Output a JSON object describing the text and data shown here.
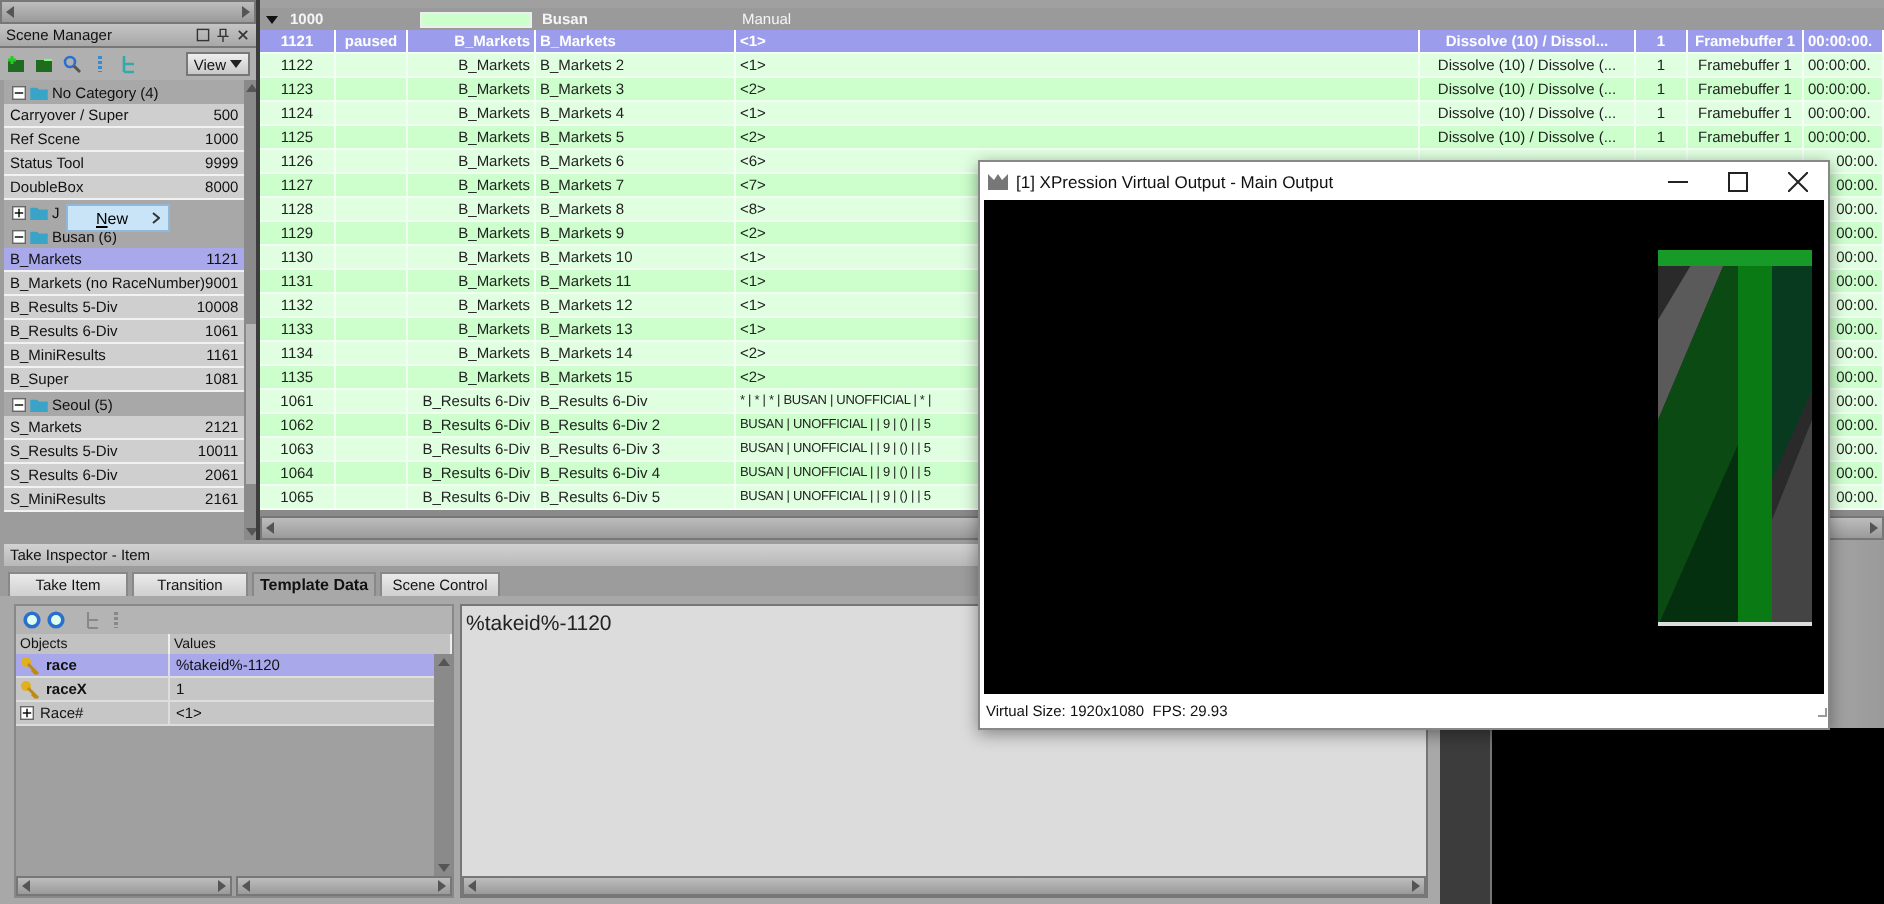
{
  "scene_manager": {
    "title": "Scene Manager",
    "view_button": "View",
    "context_menu": {
      "label": "New"
    },
    "folders": [
      {
        "label": "No Category",
        "count": "(4)",
        "expanded": true,
        "children": [
          {
            "name": "Carryover / Super",
            "number": "500",
            "selected": false
          },
          {
            "name": "Ref Scene",
            "number": "1000",
            "selected": false
          },
          {
            "name": "Status Tool",
            "number": "9999",
            "selected": false
          },
          {
            "name": "DoubleBox",
            "number": "8000",
            "selected": false
          }
        ]
      },
      {
        "label": "J",
        "expanded": false
      },
      {
        "label": "Busan",
        "count": "(6)",
        "expanded": true,
        "children": [
          {
            "name": "B_Markets",
            "number": "1121",
            "selected": true
          },
          {
            "name": "B_Markets (no RaceNumber)",
            "number": "9001",
            "selected": false
          },
          {
            "name": "B_Results 5-Div",
            "number": "10008",
            "selected": false
          },
          {
            "name": "B_Results 6-Div",
            "number": "1061",
            "selected": false
          },
          {
            "name": "B_MiniResults",
            "number": "1161",
            "selected": false
          },
          {
            "name": "B_Super",
            "number": "1081",
            "selected": false
          }
        ]
      },
      {
        "label": "Seoul",
        "count": "(5)",
        "expanded": true,
        "children": [
          {
            "name": "S_Markets",
            "number": "2121",
            "selected": false
          },
          {
            "name": "S_Results 5-Div",
            "number": "10011",
            "selected": false
          },
          {
            "name": "S_Results 6-Div",
            "number": "2061",
            "selected": false
          },
          {
            "name": "S_MiniResults",
            "number": "2161",
            "selected": false
          }
        ]
      }
    ]
  },
  "playlist": {
    "group": {
      "id": "1000",
      "expanded": true,
      "name": "Busan",
      "column": "Manual"
    },
    "rows": [
      {
        "id": "1121",
        "status": "paused",
        "scene": "B_Markets",
        "name": "B_Markets",
        "manual": "<1>",
        "transition": "Dissolve (10) / Dissol...",
        "count": "1",
        "framebuffer": "Framebuffer 1",
        "time": "00:00:00.",
        "selected": true
      },
      {
        "id": "1122",
        "scene": "B_Markets",
        "name": "B_Markets 2",
        "manual": "<1>",
        "transition": "Dissolve (10) / Dissolve (...",
        "count": "1",
        "framebuffer": "Framebuffer 1",
        "time": "00:00:00.",
        "selected": false
      },
      {
        "id": "1123",
        "scene": "B_Markets",
        "name": "B_Markets 3",
        "manual": "<2>",
        "transition": "Dissolve (10) / Dissolve (...",
        "count": "1",
        "framebuffer": "Framebuffer 1",
        "time": "00:00:00.",
        "selected": false
      },
      {
        "id": "1124",
        "scene": "B_Markets",
        "name": "B_Markets 4",
        "manual": "<1>",
        "transition": "Dissolve (10) / Dissolve (...",
        "count": "1",
        "framebuffer": "Framebuffer 1",
        "time": "00:00:00.",
        "selected": false
      },
      {
        "id": "1125",
        "scene": "B_Markets",
        "name": "B_Markets 5",
        "manual": "<2>",
        "transition": "Dissolve (10) / Dissolve (...",
        "count": "1",
        "framebuffer": "Framebuffer 1",
        "time": "00:00:00.",
        "selected": false
      },
      {
        "id": "1126",
        "scene": "B_Markets",
        "name": "B_Markets 6",
        "manual": "<6>",
        "time": "00:00.",
        "selected": false
      },
      {
        "id": "1127",
        "scene": "B_Markets",
        "name": "B_Markets 7",
        "manual": "<7>",
        "time": "00:00.",
        "selected": false
      },
      {
        "id": "1128",
        "scene": "B_Markets",
        "name": "B_Markets 8",
        "manual": "<8>",
        "time": "00:00.",
        "selected": false
      },
      {
        "id": "1129",
        "scene": "B_Markets",
        "name": "B_Markets 9",
        "manual": "<2>",
        "time": "00:00.",
        "selected": false
      },
      {
        "id": "1130",
        "scene": "B_Markets",
        "name": "B_Markets 10",
        "manual": "<1>",
        "time": "00:00.",
        "selected": false
      },
      {
        "id": "1131",
        "scene": "B_Markets",
        "name": "B_Markets 11",
        "manual": "<1>",
        "time": "00:00.",
        "selected": false
      },
      {
        "id": "1132",
        "scene": "B_Markets",
        "name": "B_Markets 12",
        "manual": "<1>",
        "time": "00:00.",
        "selected": false
      },
      {
        "id": "1133",
        "scene": "B_Markets",
        "name": "B_Markets 13",
        "manual": "<1>",
        "time": "00:00.",
        "selected": false
      },
      {
        "id": "1134",
        "scene": "B_Markets",
        "name": "B_Markets 14",
        "manual": "<2>",
        "time": "00:00.",
        "selected": false
      },
      {
        "id": "1135",
        "scene": "B_Markets",
        "name": "B_Markets 15",
        "manual": "<2>",
        "time": "00:00.",
        "selected": false
      },
      {
        "id": "1061",
        "scene": "B_Results 6-Div",
        "name": "B_Results 6-Div",
        "manual": "* | * | * | BUSAN | UNOFFICIAL | * |",
        "time": "00:00.",
        "selected": false
      },
      {
        "id": "1062",
        "scene": "B_Results 6-Div",
        "name": "B_Results 6-Div 2",
        "manual": "BUSAN | UNOFFICIAL | | 9 | () | | 5",
        "time": "00:00.",
        "selected": false
      },
      {
        "id": "1063",
        "scene": "B_Results 6-Div",
        "name": "B_Results 6-Div 3",
        "manual": "BUSAN | UNOFFICIAL | | 9 | () | | 5",
        "time": "00:00.",
        "selected": false
      },
      {
        "id": "1064",
        "scene": "B_Results 6-Div",
        "name": "B_Results 6-Div 4",
        "manual": "BUSAN | UNOFFICIAL | | 9 | () | | 5",
        "time": "00:00.",
        "selected": false
      },
      {
        "id": "1065",
        "scene": "B_Results 6-Div",
        "name": "B_Results 6-Div 5",
        "manual": "BUSAN | UNOFFICIAL | | 9 | () | | 5",
        "time": "00:00.",
        "selected": false
      }
    ]
  },
  "take_inspector": {
    "title": "Take Inspector - Item",
    "tabs": [
      {
        "label": "Take Item",
        "selected": false
      },
      {
        "label": "Transition",
        "selected": false
      },
      {
        "label": "Template Data",
        "selected": true
      },
      {
        "label": "Scene Control",
        "selected": false
      }
    ],
    "columns": [
      "Objects",
      "Values"
    ],
    "objects": [
      {
        "kind": "key",
        "name": "race",
        "value": "%takeid%-1120",
        "selected": true
      },
      {
        "kind": "key",
        "name": "raceX",
        "value": "1",
        "selected": false
      },
      {
        "kind": "group",
        "name": "Race#",
        "value": "<1>",
        "expanded": false,
        "selected": false
      }
    ],
    "editor_text": "%takeid%-1120"
  },
  "output_window": {
    "title": "[1] XPression Virtual Output - Main Output",
    "status": "Virtual Size: 1920x1080  FPS: 29.93"
  }
}
